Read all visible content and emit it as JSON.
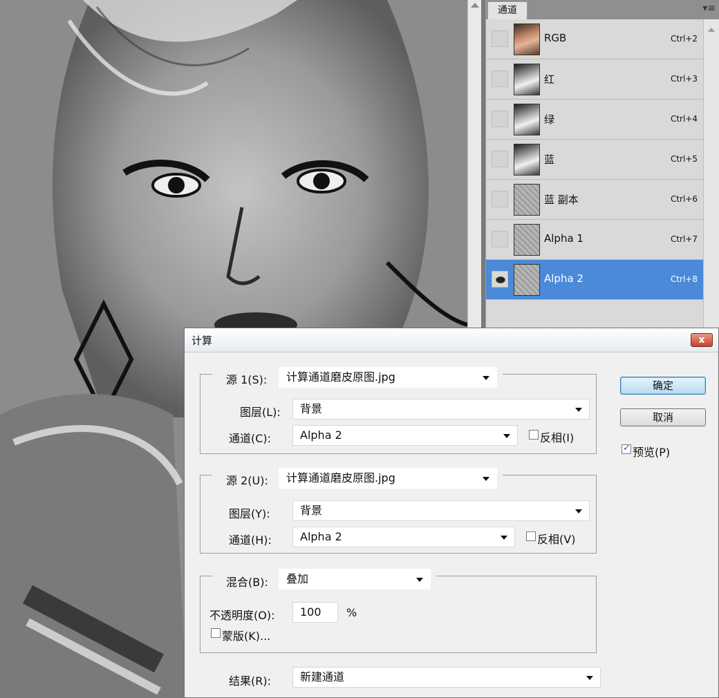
{
  "channels_panel": {
    "tab_label": "通道",
    "menu_icon": "panel-menu-icon",
    "rows": [
      {
        "name": "RGB",
        "shortcut": "Ctrl+2",
        "thumb": "color",
        "visible": false,
        "selected": false
      },
      {
        "name": "红",
        "shortcut": "Ctrl+3",
        "thumb": "gray",
        "visible": false,
        "selected": false
      },
      {
        "name": "绿",
        "shortcut": "Ctrl+4",
        "thumb": "gray",
        "visible": false,
        "selected": false
      },
      {
        "name": "蓝",
        "shortcut": "Ctrl+5",
        "thumb": "gray",
        "visible": false,
        "selected": false
      },
      {
        "name": "蓝 副本",
        "shortcut": "Ctrl+6",
        "thumb": "noise",
        "visible": false,
        "selected": false
      },
      {
        "name": "Alpha 1",
        "shortcut": "Ctrl+7",
        "thumb": "noise",
        "visible": false,
        "selected": false
      },
      {
        "name": "Alpha 2",
        "shortcut": "Ctrl+8",
        "thumb": "noise",
        "visible": true,
        "selected": true
      }
    ]
  },
  "dialog": {
    "title": "计算",
    "close_label": "x",
    "source1": {
      "label": "源 1(S):",
      "file": "计算通道磨皮原图.jpg",
      "layer_label": "图层(L):",
      "layer": "背景",
      "channel_label": "通道(C):",
      "channel": "Alpha 2",
      "invert_label": "反相(I)",
      "invert": false
    },
    "source2": {
      "label": "源 2(U):",
      "file": "计算通道磨皮原图.jpg",
      "layer_label": "图层(Y):",
      "layer": "背景",
      "channel_label": "通道(H):",
      "channel": "Alpha 2",
      "invert_label": "反相(V)",
      "invert": false
    },
    "blend": {
      "label": "混合(B):",
      "mode": "叠加",
      "opacity_label": "不透明度(O):",
      "opacity": "100",
      "opacity_unit": "%",
      "mask_label": "蒙版(K)...",
      "mask": false
    },
    "result": {
      "label": "结果(R):",
      "value": "新建通道"
    },
    "ok_label": "确定",
    "cancel_label": "取消",
    "preview_label": "预览(P)",
    "preview": true
  },
  "colors": {
    "selection": "#4a8ad8",
    "dialog_bg": "#f0f0f0"
  }
}
